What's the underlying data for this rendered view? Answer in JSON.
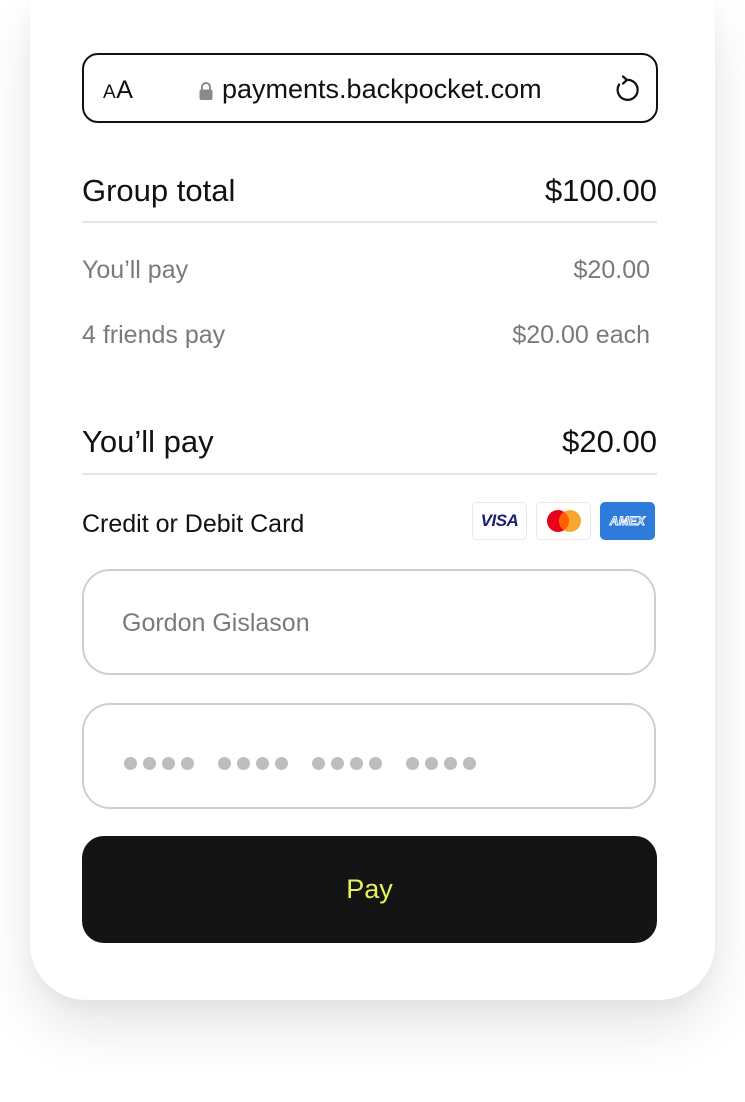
{
  "browser": {
    "aa_small": "A",
    "aa_large": "A",
    "url": "payments.backpocket.com",
    "icons": [
      "lock-icon",
      "reload-icon"
    ]
  },
  "summary": {
    "group_total_label": "Group total",
    "group_total_value": "$100.00",
    "you_pay_label": "You’ll pay",
    "you_pay_value": "$20.00",
    "friends_label": "4 friends pay",
    "friends_value": "$20.00 each"
  },
  "total": {
    "label": "You’ll pay",
    "value": "$20.00"
  },
  "payment": {
    "section_label": "Credit or Debit Card",
    "brands": [
      "VISA",
      "AMEX"
    ],
    "brand_icons": [
      "visa-icon",
      "mastercard-icon",
      "amex-icon"
    ],
    "name_placeholder": "Gordon Gislason",
    "card_groups": 4,
    "digits_per_group": 4
  },
  "pay_button": {
    "label": "Pay"
  },
  "colors": {
    "text": "#111111",
    "muted": "#7a7a7a",
    "button_bg": "#141414",
    "button_text": "#e4f35a",
    "amex_blue": "#2f7bd9",
    "visa_navy": "#1a1f71",
    "mc_red": "#eb001b",
    "mc_orange": "#f79e1b"
  }
}
